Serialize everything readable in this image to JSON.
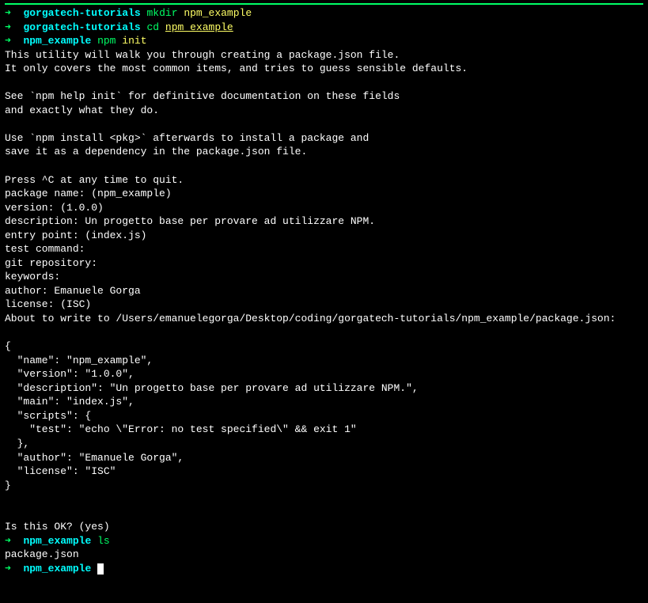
{
  "prompts": {
    "arrow": "➜",
    "dir1": "gorgatech-tutorials",
    "dir2": "npm_example"
  },
  "commands": {
    "mkdir": {
      "cmd": "mkdir",
      "arg": "npm_example"
    },
    "cd": {
      "cmd": "cd",
      "arg": "npm_example"
    },
    "npm": {
      "cmd": "npm",
      "arg": "init"
    },
    "ls": {
      "cmd": "ls",
      "arg": ""
    }
  },
  "output": {
    "intro1": "This utility will walk you through creating a package.json file.",
    "intro2": "It only covers the most common items, and tries to guess sensible defaults.",
    "help1": "See `npm help init` for definitive documentation on these fields",
    "help2": "and exactly what they do.",
    "use1": "Use `npm install <pkg>` afterwards to install a package and",
    "use2": "save it as a dependency in the package.json file.",
    "quit": "Press ^C at any time to quit.",
    "pkg_name": "package name: (npm_example)",
    "version": "version: (1.0.0)",
    "description": "description: Un progetto base per provare ad utilizzare NPM.",
    "entry": "entry point: (index.js)",
    "test": "test command:",
    "git": "git repository:",
    "keywords": "keywords:",
    "author": "author: Emanuele Gorga",
    "license": "license: (ISC)",
    "about": "About to write to /Users/emanuelegorga/Desktop/coding/gorgatech-tutorials/npm_example/package.json:",
    "json_open": "{",
    "json_name": "  \"name\": \"npm_example\",",
    "json_version": "  \"version\": \"1.0.0\",",
    "json_desc": "  \"description\": \"Un progetto base per provare ad utilizzare NPM.\",",
    "json_main": "  \"main\": \"index.js\",",
    "json_scripts": "  \"scripts\": {",
    "json_test": "    \"test\": \"echo \\\"Error: no test specified\\\" && exit 1\"",
    "json_scripts_close": "  },",
    "json_author": "  \"author\": \"Emanuele Gorga\",",
    "json_license": "  \"license\": \"ISC\"",
    "json_close": "}",
    "confirm": "Is this OK? (yes)",
    "ls_output": "package.json"
  }
}
